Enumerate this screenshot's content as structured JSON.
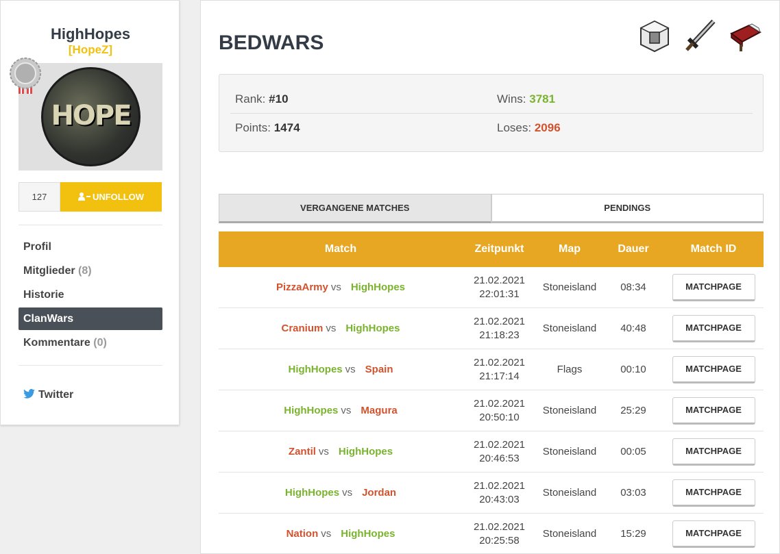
{
  "clan": {
    "name": "HighHopes",
    "tag": "[HopeZ]",
    "avatar_text": "HOPE",
    "followers": "127",
    "unfollow_label": "UNFOLLOW"
  },
  "nav": [
    {
      "label": "Profil",
      "count": ""
    },
    {
      "label": "Mitglieder",
      "count": "(8)"
    },
    {
      "label": "Historie",
      "count": ""
    },
    {
      "label": "ClanWars",
      "count": ""
    },
    {
      "label": "Kommentare",
      "count": "(0)"
    }
  ],
  "social": {
    "twitter": "Twitter"
  },
  "page": {
    "title": "BEDWARS",
    "icons": [
      "block-icon",
      "sword-icon",
      "bed-icon"
    ]
  },
  "stats": {
    "rank_label": "Rank:",
    "rank": "#10",
    "wins_label": "Wins:",
    "wins": "3781",
    "points_label": "Points:",
    "points": "1474",
    "loses_label": "Loses:",
    "loses": "2096"
  },
  "tabs": [
    "VERGANGENE MATCHES",
    "PENDINGS"
  ],
  "table": {
    "headers": [
      "Match",
      "Zeitpunkt",
      "Map",
      "Dauer",
      "Match ID"
    ],
    "vs": "vs",
    "button_label": "MATCHPAGE",
    "rows": [
      {
        "team1": "PizzaArmy",
        "team1_result": "lose",
        "team2": "HighHopes",
        "team2_result": "win",
        "date": "21.02.2021",
        "time": "22:01:31",
        "map": "Stoneisland",
        "duration": "08:34"
      },
      {
        "team1": "Cranium",
        "team1_result": "lose",
        "team2": "HighHopes",
        "team2_result": "win",
        "date": "21.02.2021",
        "time": "21:18:23",
        "map": "Stoneisland",
        "duration": "40:48"
      },
      {
        "team1": "HighHopes",
        "team1_result": "win",
        "team2": "Spain",
        "team2_result": "lose",
        "date": "21.02.2021",
        "time": "21:17:14",
        "map": "Flags",
        "duration": "00:10"
      },
      {
        "team1": "HighHopes",
        "team1_result": "win",
        "team2": "Magura",
        "team2_result": "lose",
        "date": "21.02.2021",
        "time": "20:50:10",
        "map": "Stoneisland",
        "duration": "25:29"
      },
      {
        "team1": "Zantil",
        "team1_result": "lose",
        "team2": "HighHopes",
        "team2_result": "win",
        "date": "21.02.2021",
        "time": "20:46:53",
        "map": "Stoneisland",
        "duration": "00:05"
      },
      {
        "team1": "HighHopes",
        "team1_result": "win",
        "team2": "Jordan",
        "team2_result": "lose",
        "date": "21.02.2021",
        "time": "20:43:03",
        "map": "Stoneisland",
        "duration": "03:03"
      },
      {
        "team1": "Nation",
        "team1_result": "lose",
        "team2": "HighHopes",
        "team2_result": "win",
        "date": "21.02.2021",
        "time": "20:25:58",
        "map": "Stoneisland",
        "duration": "15:29"
      }
    ]
  },
  "colors": {
    "accent": "#f2c10f",
    "table_header": "#e7a722",
    "win": "#7ab32e",
    "lose": "#d0532e",
    "nav_active": "#4a5058"
  }
}
